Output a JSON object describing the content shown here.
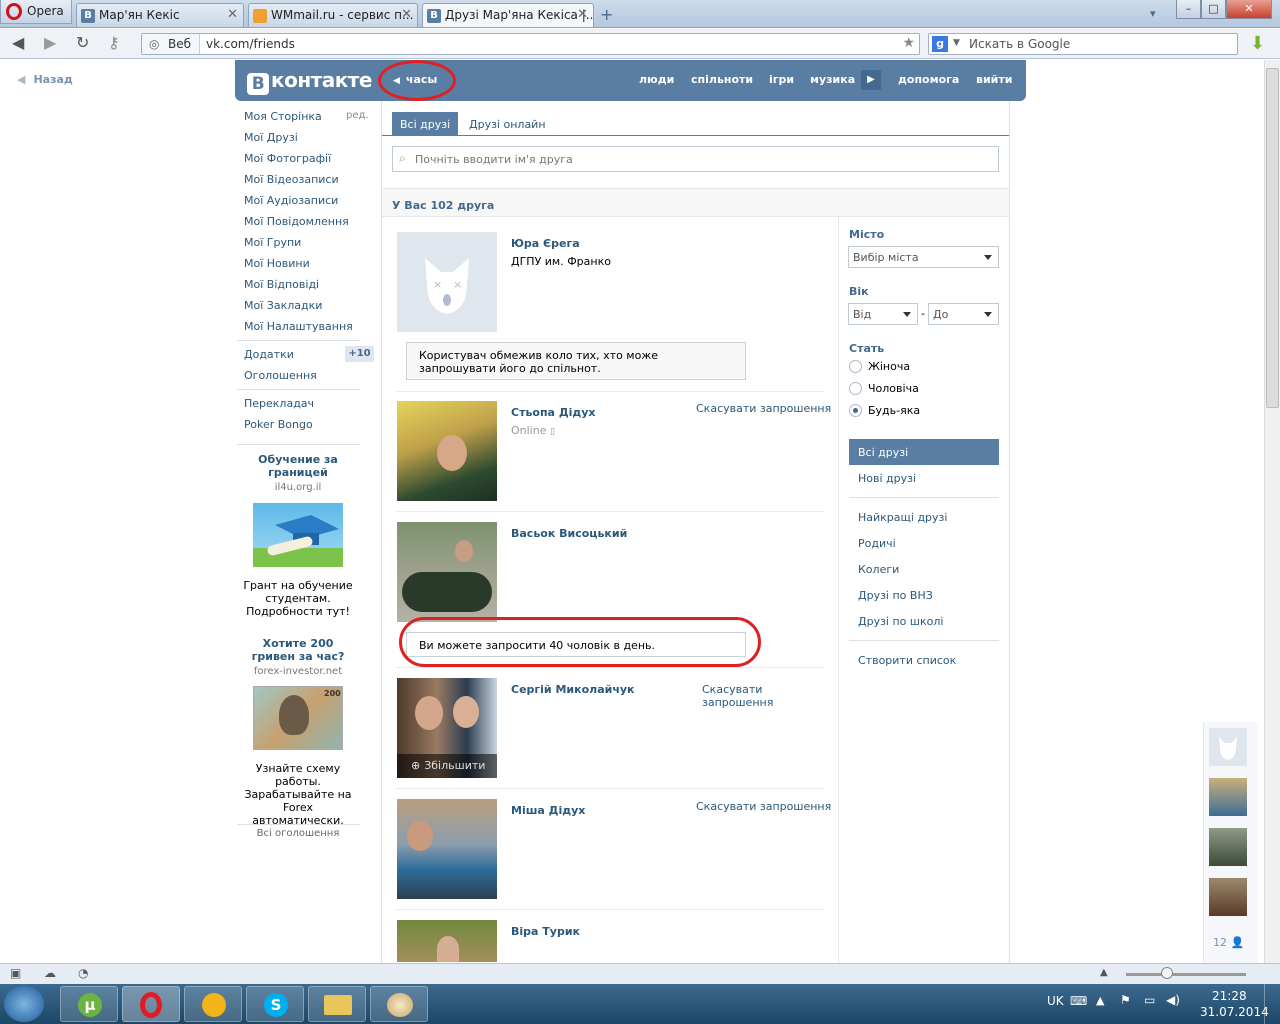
{
  "browser": {
    "menu_label": "Opera",
    "tabs": [
      {
        "title": "Мар'ян Кекіс",
        "favicon": "В"
      },
      {
        "title": "WMmail.ru - сервис п...",
        "favicon": "W"
      },
      {
        "title": "Друзі Мар'яна Кекіса |...",
        "favicon": "В"
      }
    ],
    "site_label": "Веб",
    "url": "vk.com/friends",
    "search_placeholder": "Искать в Google"
  },
  "vk": {
    "back": "Назад",
    "logo": "контакте",
    "logo_letter": "В",
    "player": "часы",
    "nav": [
      "люди",
      "спільноти",
      "ігри",
      "музика",
      "допомога",
      "вийти"
    ],
    "left_menu": [
      "Моя Сторінка",
      "Мої Друзі",
      "Мої Фотографії",
      "Мої Відеозаписи",
      "Мої Аудіозаписи",
      "Мої Повідомлення",
      "Мої Групи",
      "Мої Новини",
      "Мої Відповіді",
      "Мої Закладки",
      "Мої Налаштування"
    ],
    "edit_label": "ред.",
    "apps": "Додатки",
    "apps_badge": "+10",
    "ads_link": "Оголошення",
    "translator": "Перекладач",
    "poker": "Poker Bongo",
    "ad1": {
      "title": "Обучение за границей",
      "source": "il4u.org.il",
      "text": "Грант на обучение студентам. Подробности тут!"
    },
    "ad2": {
      "title": "Хотите 200 гривен за час?",
      "source": "forex-investor.net",
      "text": "Узнайте схему работы. Зарабатывайте на Forex автоматически."
    },
    "all_ads": "Всі оголошення",
    "tabs": [
      "Всі друзі",
      "Друзі онлайн"
    ],
    "search_placeholder": "Почніть вводити ім'я друга",
    "count": "У Вас 102 друга",
    "friends": [
      {
        "name": "Юра Єрега",
        "sub": "ДГПУ им. Франко",
        "action": "",
        "notice": "Користувач обмежив коло тих, хто може запрошувати його до спільнот."
      },
      {
        "name": "Стьопа Дідух",
        "sub": "Online",
        "action": "Скасувати запрошення",
        "notice": ""
      },
      {
        "name": "Васьок Висоцький",
        "sub": "",
        "action": "",
        "notice": "Ви можете запросити 40 чоловік в день."
      },
      {
        "name": "Сергій Миколайчук",
        "sub": "",
        "action": "Скасувати запрошення",
        "notice": ""
      },
      {
        "name": "Міша Дідух",
        "sub": "",
        "action": "Скасувати запрошення",
        "notice": ""
      },
      {
        "name": "Віра Турик",
        "sub": "",
        "action": "",
        "notice": ""
      }
    ],
    "zoom_label": "Збільшити",
    "filters": {
      "city_label": "Місто",
      "city_value": "Вибір міста",
      "age_label": "Вік",
      "age_from": "Від",
      "age_dash": "-",
      "age_to": "До",
      "sex_label": "Стать",
      "sex_options": [
        "Жіноча",
        "Чоловіча",
        "Будь-яка"
      ],
      "sex_selected": "Будь-яка"
    },
    "right_menu": [
      "Всі друзі",
      "Нові друзі",
      "Найкращі друзі",
      "Родичі",
      "Колеги",
      "Друзі по ВНЗ",
      "Друзі по школі",
      "Створити список"
    ],
    "online_count": "12"
  },
  "taskbar": {
    "lang": "UK",
    "time": "21:28",
    "date": "31.07.2014"
  }
}
